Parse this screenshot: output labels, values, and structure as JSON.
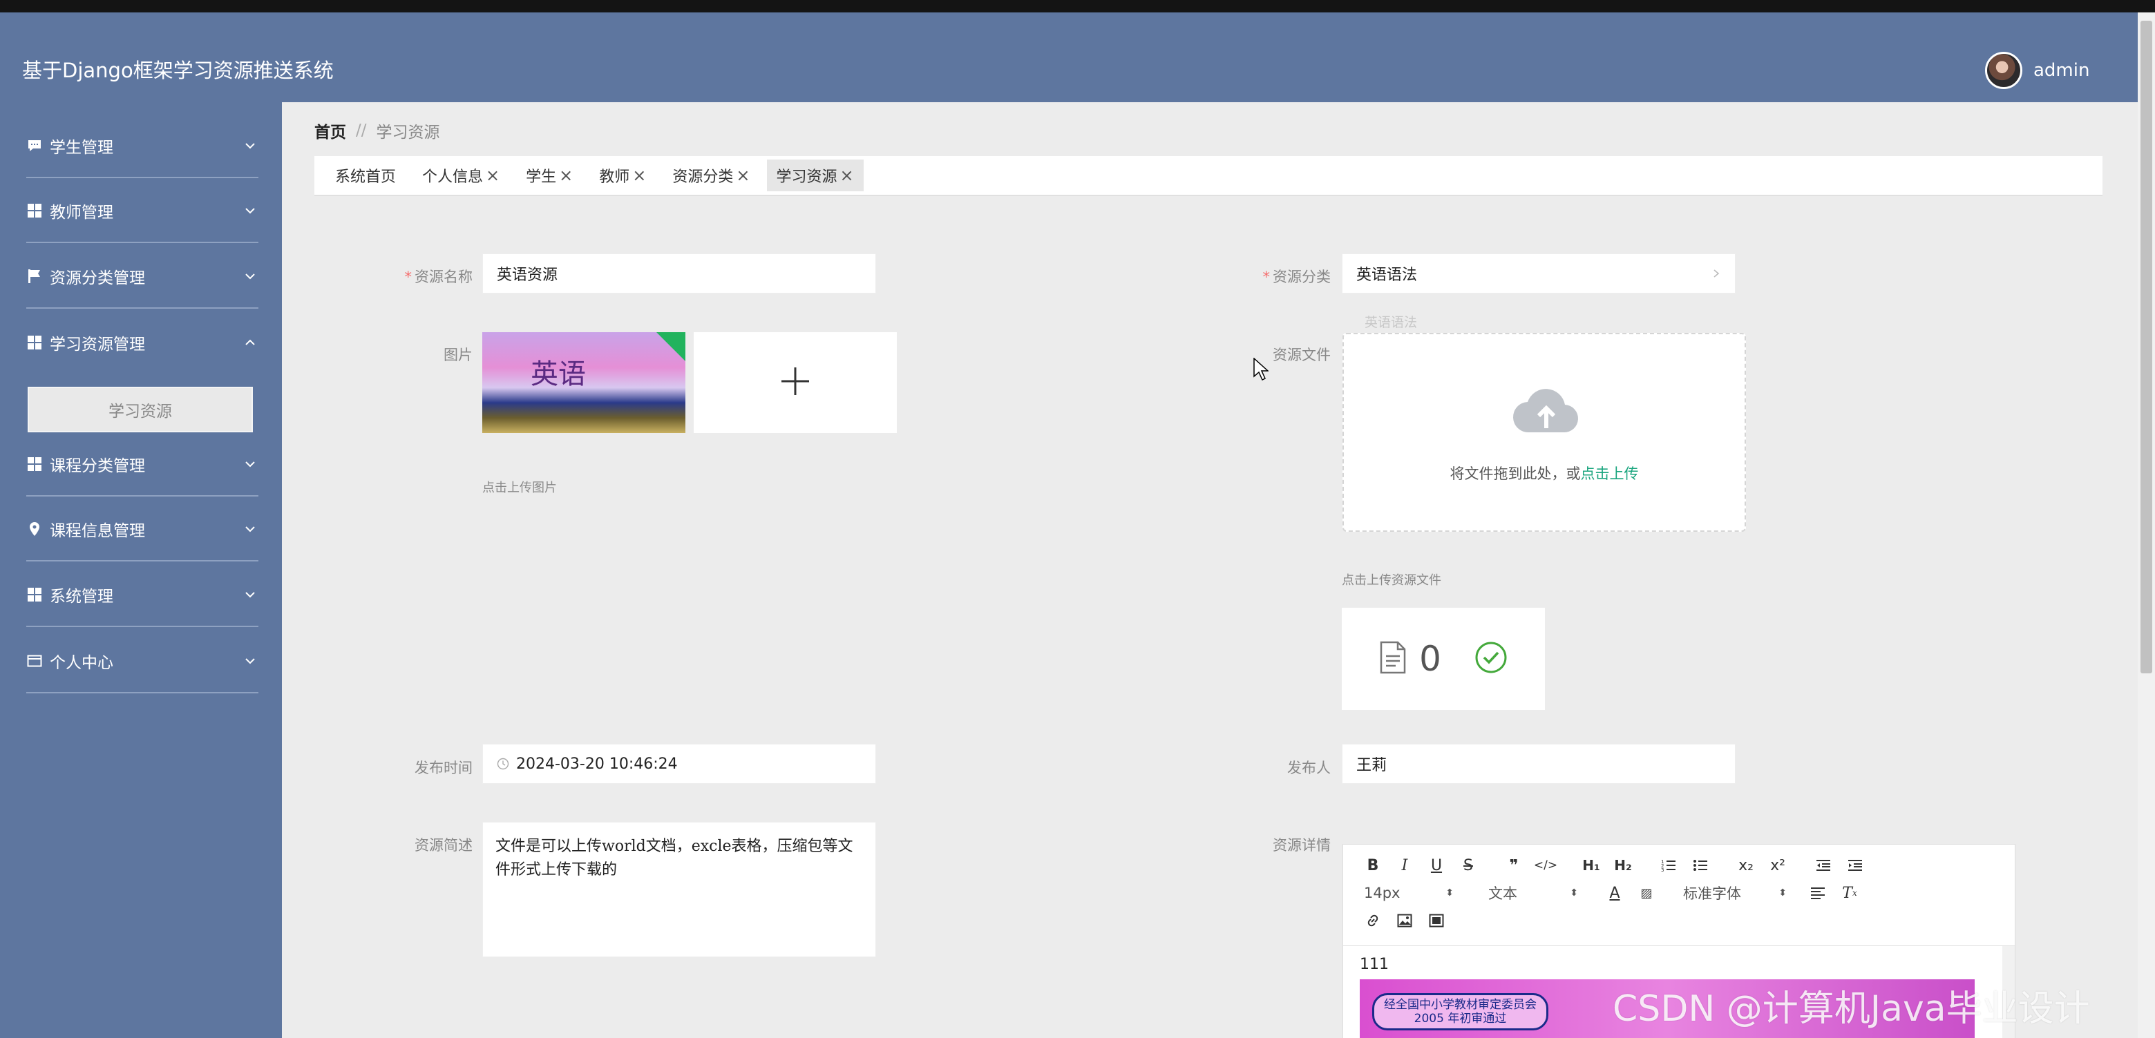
{
  "app": {
    "title": "基于Django框架学习资源推送系统",
    "username": "admin"
  },
  "sidebar": {
    "items": [
      {
        "label": "学生管理",
        "icon": "chat-icon",
        "expanded": false
      },
      {
        "label": "教师管理",
        "icon": "grid-icon",
        "expanded": false
      },
      {
        "label": "资源分类管理",
        "icon": "flag-icon",
        "expanded": false
      },
      {
        "label": "学习资源管理",
        "icon": "grid-icon",
        "expanded": true
      },
      {
        "label": "课程分类管理",
        "icon": "grid-icon",
        "expanded": false
      },
      {
        "label": "课程信息管理",
        "icon": "location-icon",
        "expanded": false
      },
      {
        "label": "系统管理",
        "icon": "grid-icon",
        "expanded": false
      },
      {
        "label": "个人中心",
        "icon": "card-icon",
        "expanded": false
      }
    ],
    "sub_item": "学习资源"
  },
  "breadcrumb": {
    "home": "首页",
    "separator": "//",
    "current": "学习资源"
  },
  "tabs": [
    {
      "label": "系统首页",
      "closable": false
    },
    {
      "label": "个人信息",
      "closable": true
    },
    {
      "label": "学生",
      "closable": true
    },
    {
      "label": "教师",
      "closable": true
    },
    {
      "label": "资源分类",
      "closable": true
    },
    {
      "label": "学习资源",
      "closable": true,
      "active": true
    }
  ],
  "tab_close": "×",
  "form": {
    "required_mark": "*",
    "name_label": "资源名称",
    "name_value": "英语资源",
    "category_label": "资源分类",
    "category_value": "英语语法",
    "ghost_option": "英语语法",
    "image_label": "图片",
    "image_cover_text": "英语",
    "image_hint": "点击上传图片",
    "file_label": "资源文件",
    "drop_text": "将文件拖到此处，或",
    "drop_link": "点击上传",
    "file_hint": "点击上传资源文件",
    "file_count": "0",
    "time_label": "发布时间",
    "time_value": "2024-03-20 10:46:24",
    "publisher_label": "发布人",
    "publisher_value": "王莉",
    "summary_label": "资源简述",
    "summary_value": "文件是可以上传world文档，excle表格，压缩包等文件形式上传下载的",
    "detail_label": "资源详情"
  },
  "editor": {
    "font_size": "14px",
    "text_type": "文本",
    "font_family": "标准字体",
    "content_text": "111",
    "image_stamp_line1": "经全国中小学教材审定委员会",
    "image_stamp_line2": "2005 年初审通过"
  },
  "watermark": "CSDN @计算机Java毕业设计"
}
